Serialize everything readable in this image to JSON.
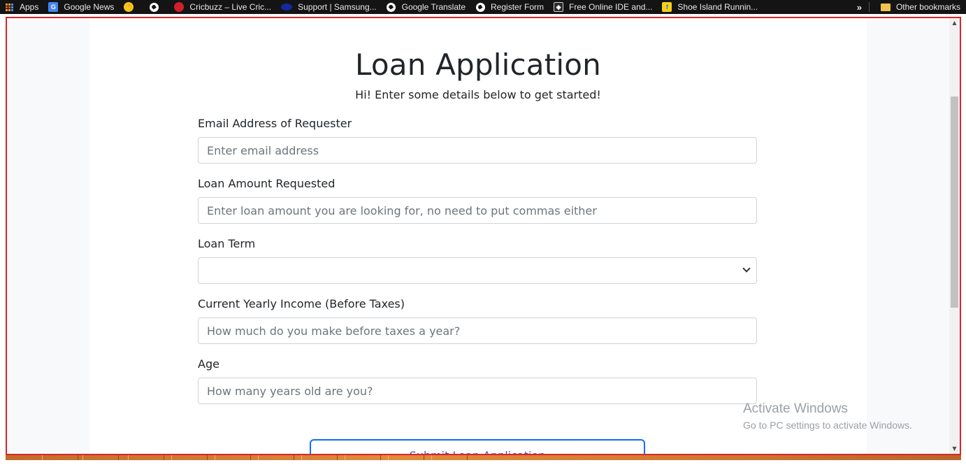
{
  "bookmarks": {
    "items": [
      {
        "label": "Apps",
        "icon": "apps-grid-icon"
      },
      {
        "label": "Google News",
        "icon": "google-news-icon"
      },
      {
        "label": "",
        "icon": "hand-icon"
      },
      {
        "label": "",
        "icon": "globe-icon"
      },
      {
        "label": "Cricbuzz – Live Cric...",
        "icon": "cricbuzz-icon"
      },
      {
        "label": "Support | Samsung...",
        "icon": "samsung-icon"
      },
      {
        "label": "Google Translate",
        "icon": "globe-icon"
      },
      {
        "label": "Register Form",
        "icon": "globe-icon"
      },
      {
        "label": "Free Online IDE and...",
        "icon": "ide-icon"
      },
      {
        "label": "Shoe Island Runnin...",
        "icon": "flipkart-icon"
      }
    ],
    "overflow": "»",
    "other": "Other bookmarks"
  },
  "form": {
    "title": "Loan Application",
    "subtitle": "Hi! Enter some details below to get started!",
    "email_label": "Email Address of Requester",
    "email_placeholder": "Enter email address",
    "amount_label": "Loan Amount Requested",
    "amount_placeholder": "Enter loan amount you are looking for, no need to put commas either",
    "term_label": "Loan Term",
    "term_value": "",
    "income_label": "Current Yearly Income (Before Taxes)",
    "income_placeholder": "How much do you make before taxes a year?",
    "age_label": "Age",
    "age_placeholder": "How many years old are you?",
    "submit_label": "Submit Loan Application"
  },
  "watermark": {
    "line1": "Activate Windows",
    "line2": "Go to PC settings to activate Windows."
  },
  "colors": {
    "accent": "#0d6efd",
    "submit_text": "#6f42c1",
    "viewport_border": "#d9262b"
  }
}
